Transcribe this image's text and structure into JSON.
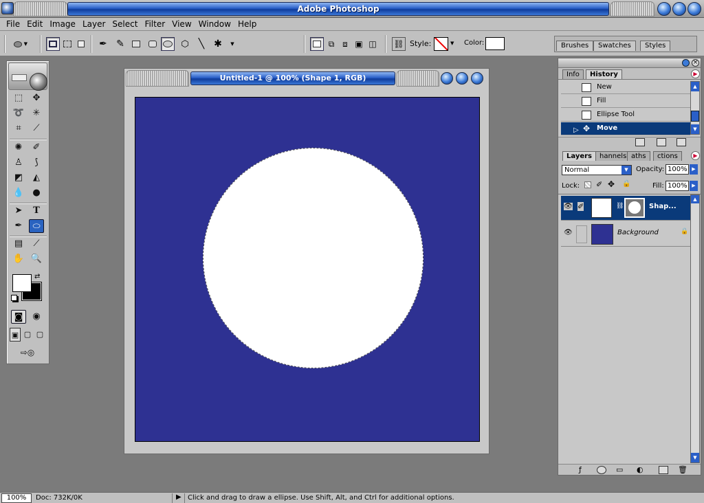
{
  "app": {
    "title": "Adobe Photoshop"
  },
  "menubar": {
    "items": [
      "File",
      "Edit",
      "Image",
      "Layer",
      "Select",
      "Filter",
      "View",
      "Window",
      "Help"
    ]
  },
  "options": {
    "style_label": "Style:",
    "color_label": "Color:",
    "color_value": "#ffffff"
  },
  "palette_well": {
    "tabs": [
      "Brushes",
      "Swatches",
      "Styles"
    ]
  },
  "document": {
    "title": "Untitled-1 @ 100% (Shape 1, RGB)",
    "canvas_color": "#2e3192",
    "shape_color": "#ffffff"
  },
  "history": {
    "tabs": [
      "Info",
      "History"
    ],
    "active_tab": "History",
    "items": [
      "New",
      "Fill",
      "Ellipse Tool",
      "Move"
    ],
    "selected": "Move"
  },
  "layers": {
    "tabs": [
      "Layers",
      "Channels",
      "Paths",
      "Actions"
    ],
    "tab_visible": [
      "Layers",
      "hannels",
      "aths",
      "ctions"
    ],
    "active_tab": "Layers",
    "blend_mode": "Normal",
    "opacity_label": "Opacity:",
    "opacity": "100%",
    "lock_label": "Lock:",
    "fill_label": "Fill:",
    "fill": "100%",
    "items": [
      {
        "name": "Shap...",
        "selected": true
      },
      {
        "name": "Background",
        "selected": false
      }
    ]
  },
  "status": {
    "zoom": "100%",
    "doc": "Doc: 732K/0K",
    "hint": "Click and drag to draw a ellipse.  Use Shift, Alt, and Ctrl for additional options."
  },
  "colors": {
    "accent": "#2a5fc8",
    "selection": "#0a3a7a",
    "chrome": "#c0c0c0"
  }
}
